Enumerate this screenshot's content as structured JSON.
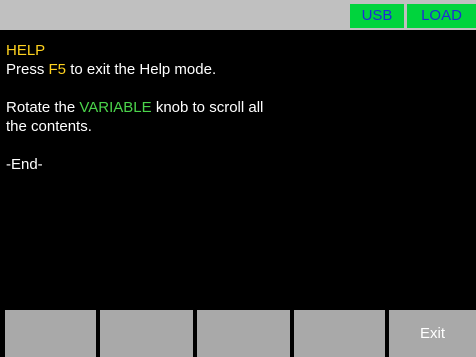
{
  "status_bar": {
    "usb_label": "USB",
    "load_label": "LOAD",
    "colors": {
      "bar": "#c0c0c0",
      "badge": "#00d43d",
      "badge_text": "#1f2bd6"
    }
  },
  "help": {
    "title": "HELP",
    "line1_pre": "Press ",
    "line1_key": "F5",
    "line1_post": " to exit the Help mode.",
    "line2_pre": "Rotate the ",
    "line2_key": "VARIABLE",
    "line2_post": " knob to scroll all",
    "line3": "the contents.",
    "end_marker": "-End-",
    "colors": {
      "title": "#ffd21f",
      "key": "#ffd21f",
      "variable": "#4bd44b",
      "text": "#ffffff"
    }
  },
  "softkeys": {
    "f1": "",
    "f2": "",
    "f3": "",
    "f4": "",
    "f5": "Exit",
    "color": "#a9a9a9"
  }
}
